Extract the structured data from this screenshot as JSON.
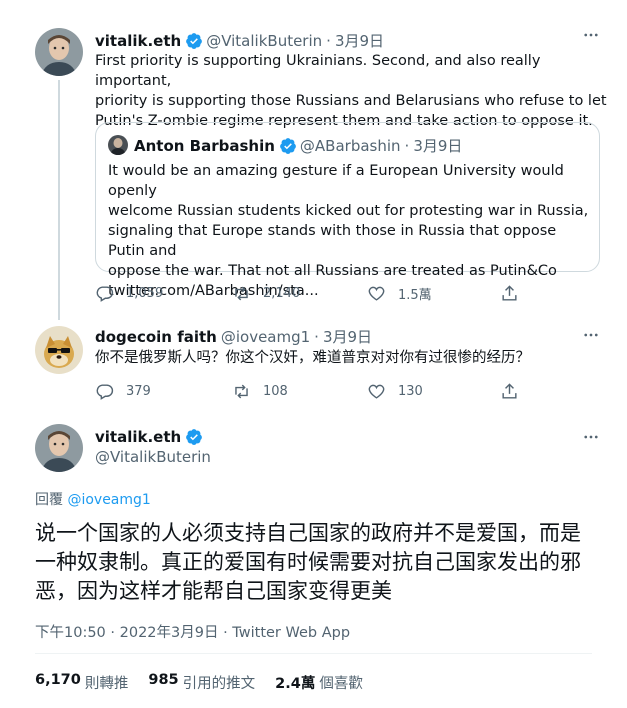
{
  "colors": {
    "accent": "#1d9bf0",
    "muted": "#536471",
    "border": "#cfd9de"
  },
  "tweet1": {
    "display_name": "vitalik.eth",
    "handle": "@VitalikButerin",
    "separator": "·",
    "date": "3月9日",
    "more_icon": "more-dots-icon",
    "text": "First priority is supporting Ukrainians. Second, and also really important,\npriority is supporting those Russians and Belarusians who refuse to let\nPutin's Z-ombie regime represent them and take action to oppose it.",
    "quote": {
      "display_name": "Anton Barbashin",
      "handle": "@ABarbashin",
      "separator": "·",
      "date": "3月9日",
      "text": "It would be an amazing gesture if a European University would openly\nwelcome Russian students kicked out for protesting war in Russia,\nsignaling that Europe stands with those in Russia that oppose Putin and\noppose the war. That not all Russians are treated as Putin&Co\ntwitter.com/ABarbashin/sta..."
    },
    "actions": {
      "replies": "1,059",
      "retweets": "2,140",
      "likes": "1.5萬"
    }
  },
  "tweet2": {
    "display_name": "dogecoin faith",
    "handle": "@ioveamg1",
    "separator": "·",
    "date": "3月9日",
    "text": "你不是俄罗斯人吗？你这个汉奸，难道普京对对你有过很惨的经历？",
    "actions": {
      "replies": "379",
      "retweets": "108",
      "likes": "130"
    }
  },
  "tweet3": {
    "display_name": "vitalik.eth",
    "handle": "@VitalikButerin",
    "reply_prefix": "回覆",
    "reply_handle": "@ioveamg1",
    "text": "说一个国家的人必须支持自己国家的政府并不是爱国，而是一种奴隶制。真正的爱国有时候需要对抗自己国家发出的邪恶，因为这样才能帮自己国家变得更美",
    "timestamp": "下午10:50 · 2022年3月9日 · Twitter Web App",
    "stats": {
      "retweets_num": "6,170",
      "retweets_label": "則轉推",
      "quotes_num": "985",
      "quotes_label": "引用的推文",
      "likes_num": "2.4萬",
      "likes_label": "個喜歡"
    }
  }
}
